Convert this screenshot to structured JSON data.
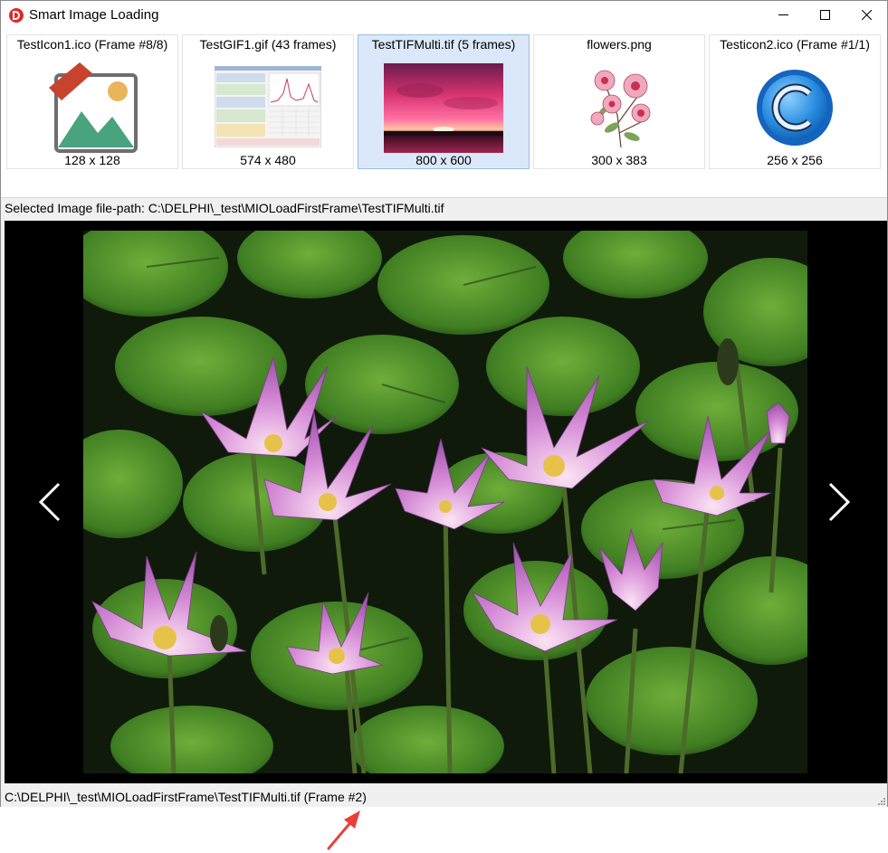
{
  "window": {
    "title": "Smart Image Loading"
  },
  "thumbnails": [
    {
      "title": "TestIcon1.ico (Frame #8/8)",
      "size": "128 x 128",
      "selected": false
    },
    {
      "title": "TestGIF1.gif (43 frames)",
      "size": "574 x 480",
      "selected": false
    },
    {
      "title": "TestTIFMulti.tif (5 frames)",
      "size": "800 x 600",
      "selected": true
    },
    {
      "title": "flowers.png",
      "size": "300 x 383",
      "selected": false
    },
    {
      "title": "Testicon2.ico (Frame #1/1)",
      "size": "256 x 256",
      "selected": false
    }
  ],
  "path_bar": {
    "text": "Selected Image file-path: C:\\DELPHI\\_test\\MIOLoadFirstFrame\\TestTIFMulti.tif"
  },
  "viewer": {
    "prev_icon": "chevron-left-icon",
    "next_icon": "chevron-right-icon"
  },
  "status_bar": {
    "text": "C:\\DELPHI\\_test\\MIOLoadFirstFrame\\TestTIFMulti.tif (Frame #2)"
  },
  "colors": {
    "selected_thumb_bg": "#dbe8fa",
    "selected_thumb_border": "#99bfe8",
    "app_icon": "#e3262b",
    "annotation_arrow": "#e8413a"
  }
}
